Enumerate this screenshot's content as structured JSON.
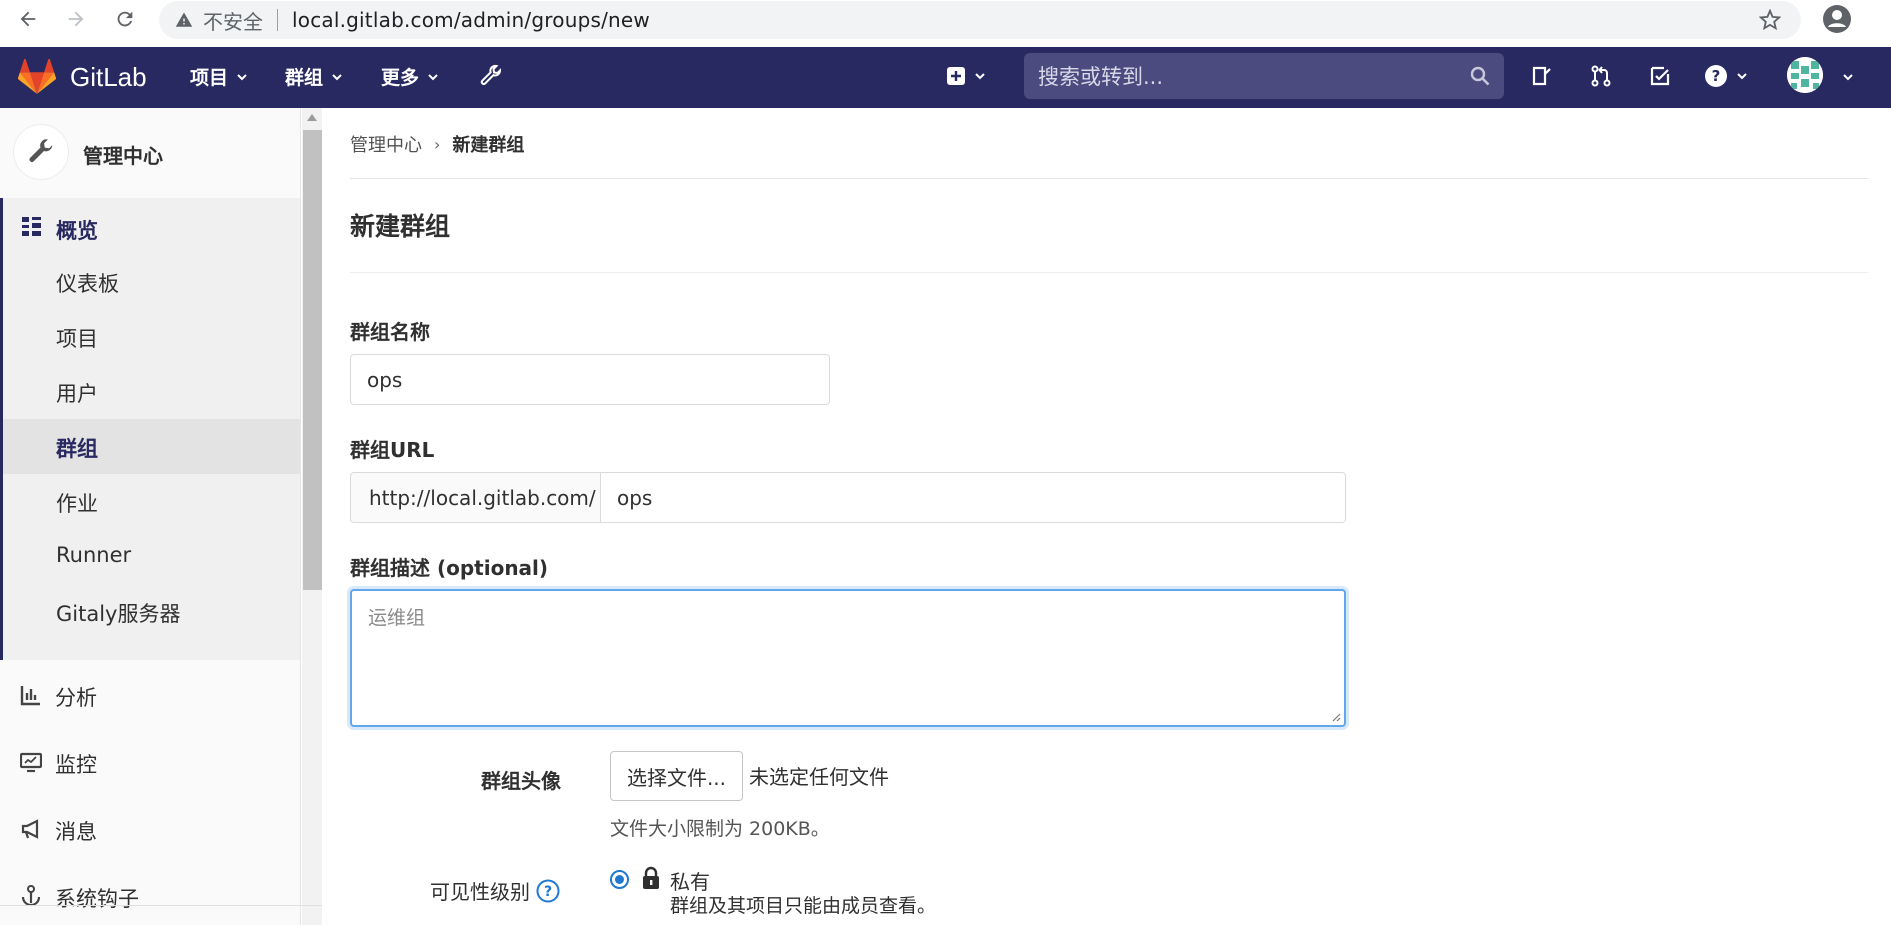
{
  "browser": {
    "security_text": "不安全",
    "url": "local.gitlab.com/admin/groups/new"
  },
  "navbar": {
    "logo_text": "GitLab",
    "menus": [
      "项目",
      "群组",
      "更多"
    ],
    "search_placeholder": "搜索或转到...",
    "bg_color": "#292961"
  },
  "sidebar": {
    "title": "管理中心",
    "overview": {
      "label": "概览",
      "items": [
        "仪表板",
        "项目",
        "用户",
        "群组",
        "作业",
        "Runner",
        "Gitaly服务器"
      ],
      "active": "群组"
    },
    "items": [
      {
        "label": "分析",
        "icon": "chart-icon"
      },
      {
        "label": "监控",
        "icon": "monitor-icon"
      },
      {
        "label": "消息",
        "icon": "bullhorn-icon"
      },
      {
        "label": "系统钩子",
        "icon": "hook-icon"
      }
    ]
  },
  "breadcrumb": {
    "parent": "管理中心",
    "current": "新建群组"
  },
  "page": {
    "title": "新建群组"
  },
  "form": {
    "name_label": "群组名称",
    "name_value": "ops",
    "url_label": "群组URL",
    "url_prefix": "http://local.gitlab.com/",
    "url_value": "ops",
    "desc_label": "群组描述",
    "desc_optional": "(optional)",
    "desc_placeholder": "运维组",
    "avatar_label": "群组头像",
    "file_button": "选择文件...",
    "file_status": "未选定任何文件",
    "file_help": "文件大小限制为 200KB。",
    "visibility_label": "可见性级别",
    "visibility_private": "私有",
    "visibility_private_desc": "群组及其项目只能由成员查看。"
  }
}
